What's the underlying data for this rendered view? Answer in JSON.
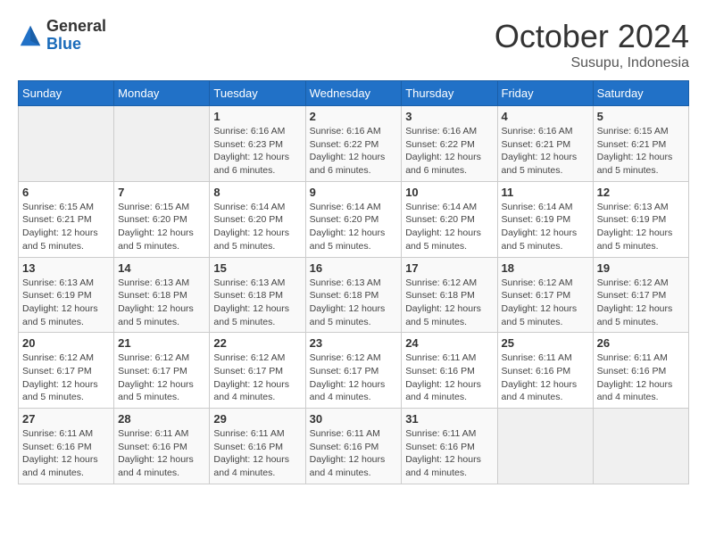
{
  "logo": {
    "general": "General",
    "blue": "Blue"
  },
  "header": {
    "month": "October 2024",
    "location": "Susupu, Indonesia"
  },
  "weekdays": [
    "Sunday",
    "Monday",
    "Tuesday",
    "Wednesday",
    "Thursday",
    "Friday",
    "Saturday"
  ],
  "weeks": [
    [
      {
        "day": "",
        "sunrise": "",
        "sunset": "",
        "daylight": ""
      },
      {
        "day": "",
        "sunrise": "",
        "sunset": "",
        "daylight": ""
      },
      {
        "day": "1",
        "sunrise": "Sunrise: 6:16 AM",
        "sunset": "Sunset: 6:23 PM",
        "daylight": "Daylight: 12 hours and 6 minutes."
      },
      {
        "day": "2",
        "sunrise": "Sunrise: 6:16 AM",
        "sunset": "Sunset: 6:22 PM",
        "daylight": "Daylight: 12 hours and 6 minutes."
      },
      {
        "day": "3",
        "sunrise": "Sunrise: 6:16 AM",
        "sunset": "Sunset: 6:22 PM",
        "daylight": "Daylight: 12 hours and 6 minutes."
      },
      {
        "day": "4",
        "sunrise": "Sunrise: 6:16 AM",
        "sunset": "Sunset: 6:21 PM",
        "daylight": "Daylight: 12 hours and 5 minutes."
      },
      {
        "day": "5",
        "sunrise": "Sunrise: 6:15 AM",
        "sunset": "Sunset: 6:21 PM",
        "daylight": "Daylight: 12 hours and 5 minutes."
      }
    ],
    [
      {
        "day": "6",
        "sunrise": "Sunrise: 6:15 AM",
        "sunset": "Sunset: 6:21 PM",
        "daylight": "Daylight: 12 hours and 5 minutes."
      },
      {
        "day": "7",
        "sunrise": "Sunrise: 6:15 AM",
        "sunset": "Sunset: 6:20 PM",
        "daylight": "Daylight: 12 hours and 5 minutes."
      },
      {
        "day": "8",
        "sunrise": "Sunrise: 6:14 AM",
        "sunset": "Sunset: 6:20 PM",
        "daylight": "Daylight: 12 hours and 5 minutes."
      },
      {
        "day": "9",
        "sunrise": "Sunrise: 6:14 AM",
        "sunset": "Sunset: 6:20 PM",
        "daylight": "Daylight: 12 hours and 5 minutes."
      },
      {
        "day": "10",
        "sunrise": "Sunrise: 6:14 AM",
        "sunset": "Sunset: 6:20 PM",
        "daylight": "Daylight: 12 hours and 5 minutes."
      },
      {
        "day": "11",
        "sunrise": "Sunrise: 6:14 AM",
        "sunset": "Sunset: 6:19 PM",
        "daylight": "Daylight: 12 hours and 5 minutes."
      },
      {
        "day": "12",
        "sunrise": "Sunrise: 6:13 AM",
        "sunset": "Sunset: 6:19 PM",
        "daylight": "Daylight: 12 hours and 5 minutes."
      }
    ],
    [
      {
        "day": "13",
        "sunrise": "Sunrise: 6:13 AM",
        "sunset": "Sunset: 6:19 PM",
        "daylight": "Daylight: 12 hours and 5 minutes."
      },
      {
        "day": "14",
        "sunrise": "Sunrise: 6:13 AM",
        "sunset": "Sunset: 6:18 PM",
        "daylight": "Daylight: 12 hours and 5 minutes."
      },
      {
        "day": "15",
        "sunrise": "Sunrise: 6:13 AM",
        "sunset": "Sunset: 6:18 PM",
        "daylight": "Daylight: 12 hours and 5 minutes."
      },
      {
        "day": "16",
        "sunrise": "Sunrise: 6:13 AM",
        "sunset": "Sunset: 6:18 PM",
        "daylight": "Daylight: 12 hours and 5 minutes."
      },
      {
        "day": "17",
        "sunrise": "Sunrise: 6:12 AM",
        "sunset": "Sunset: 6:18 PM",
        "daylight": "Daylight: 12 hours and 5 minutes."
      },
      {
        "day": "18",
        "sunrise": "Sunrise: 6:12 AM",
        "sunset": "Sunset: 6:17 PM",
        "daylight": "Daylight: 12 hours and 5 minutes."
      },
      {
        "day": "19",
        "sunrise": "Sunrise: 6:12 AM",
        "sunset": "Sunset: 6:17 PM",
        "daylight": "Daylight: 12 hours and 5 minutes."
      }
    ],
    [
      {
        "day": "20",
        "sunrise": "Sunrise: 6:12 AM",
        "sunset": "Sunset: 6:17 PM",
        "daylight": "Daylight: 12 hours and 5 minutes."
      },
      {
        "day": "21",
        "sunrise": "Sunrise: 6:12 AM",
        "sunset": "Sunset: 6:17 PM",
        "daylight": "Daylight: 12 hours and 5 minutes."
      },
      {
        "day": "22",
        "sunrise": "Sunrise: 6:12 AM",
        "sunset": "Sunset: 6:17 PM",
        "daylight": "Daylight: 12 hours and 4 minutes."
      },
      {
        "day": "23",
        "sunrise": "Sunrise: 6:12 AM",
        "sunset": "Sunset: 6:17 PM",
        "daylight": "Daylight: 12 hours and 4 minutes."
      },
      {
        "day": "24",
        "sunrise": "Sunrise: 6:11 AM",
        "sunset": "Sunset: 6:16 PM",
        "daylight": "Daylight: 12 hours and 4 minutes."
      },
      {
        "day": "25",
        "sunrise": "Sunrise: 6:11 AM",
        "sunset": "Sunset: 6:16 PM",
        "daylight": "Daylight: 12 hours and 4 minutes."
      },
      {
        "day": "26",
        "sunrise": "Sunrise: 6:11 AM",
        "sunset": "Sunset: 6:16 PM",
        "daylight": "Daylight: 12 hours and 4 minutes."
      }
    ],
    [
      {
        "day": "27",
        "sunrise": "Sunrise: 6:11 AM",
        "sunset": "Sunset: 6:16 PM",
        "daylight": "Daylight: 12 hours and 4 minutes."
      },
      {
        "day": "28",
        "sunrise": "Sunrise: 6:11 AM",
        "sunset": "Sunset: 6:16 PM",
        "daylight": "Daylight: 12 hours and 4 minutes."
      },
      {
        "day": "29",
        "sunrise": "Sunrise: 6:11 AM",
        "sunset": "Sunset: 6:16 PM",
        "daylight": "Daylight: 12 hours and 4 minutes."
      },
      {
        "day": "30",
        "sunrise": "Sunrise: 6:11 AM",
        "sunset": "Sunset: 6:16 PM",
        "daylight": "Daylight: 12 hours and 4 minutes."
      },
      {
        "day": "31",
        "sunrise": "Sunrise: 6:11 AM",
        "sunset": "Sunset: 6:16 PM",
        "daylight": "Daylight: 12 hours and 4 minutes."
      },
      {
        "day": "",
        "sunrise": "",
        "sunset": "",
        "daylight": ""
      },
      {
        "day": "",
        "sunrise": "",
        "sunset": "",
        "daylight": ""
      }
    ]
  ]
}
